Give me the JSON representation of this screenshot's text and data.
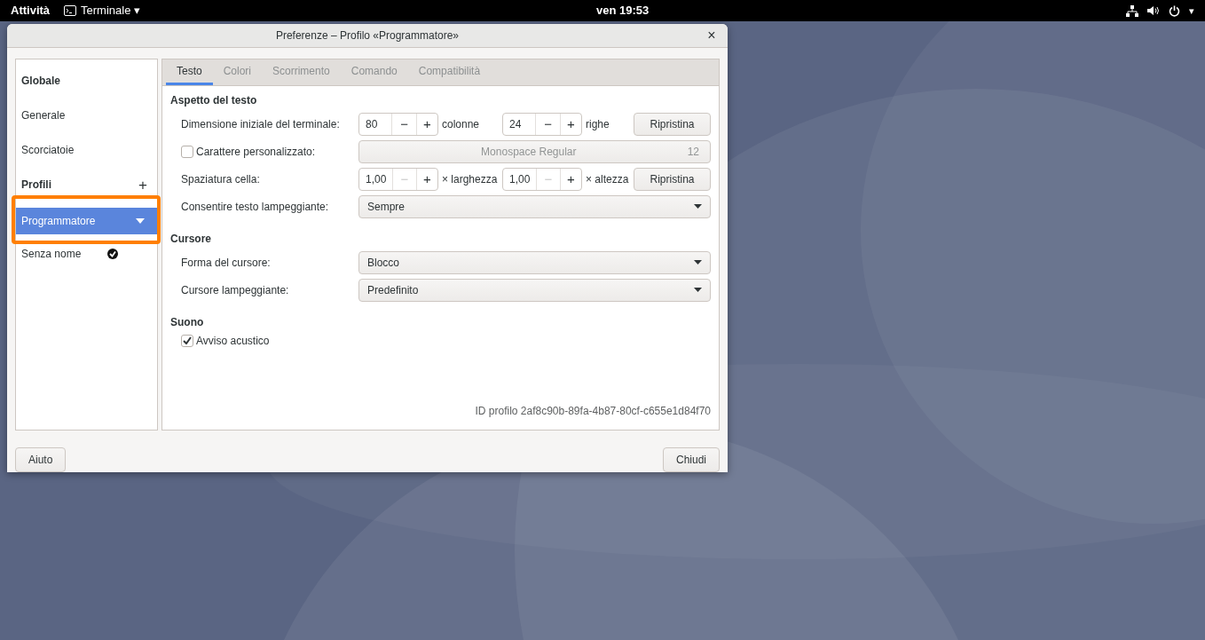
{
  "top_bar": {
    "activities": "Attività",
    "app_menu": {
      "label": "Terminale",
      "caret": "▾"
    },
    "clock": "ven 19:53",
    "system_caret": "▾"
  },
  "dialog": {
    "title": "Preferenze – Profilo «Programmatore»",
    "close": "×"
  },
  "sidebar": {
    "items": [
      {
        "kind": "header",
        "label": "Globale"
      },
      {
        "kind": "item",
        "label": "Generale",
        "selected": false
      },
      {
        "kind": "item",
        "label": "Scorciatoie",
        "selected": false
      },
      {
        "kind": "header",
        "label": "Profili",
        "action": "+"
      },
      {
        "kind": "profile",
        "label": "Programmatore",
        "selected": true,
        "highlighted": true,
        "default": false
      },
      {
        "kind": "profile",
        "label": "Senza nome",
        "selected": false,
        "highlighted": false,
        "default": true
      }
    ]
  },
  "tabs": [
    {
      "label": "Testo",
      "selected": true
    },
    {
      "label": "Colori",
      "selected": false
    },
    {
      "label": "Scorrimento",
      "selected": false
    },
    {
      "label": "Comando",
      "selected": false
    },
    {
      "label": "Compatibilità",
      "selected": false
    }
  ],
  "sections": [
    {
      "title": "Aspetto del testo",
      "rows": [
        {
          "kind": "spins",
          "label": "Dimensione iniziale del terminale:",
          "spins": [
            {
              "value": "80",
              "minus": "−",
              "plus": "+",
              "minus_disabled": false,
              "unit": "colonne"
            },
            {
              "value": "24",
              "minus": "−",
              "plus": "+",
              "minus_disabled": false,
              "unit": "righe"
            }
          ],
          "button": "Ripristina"
        },
        {
          "kind": "font",
          "label": "Carattere personalizzato:",
          "checked": false,
          "font": "Monospace Regular",
          "size": "12",
          "disabled": true
        },
        {
          "kind": "spins",
          "label": "Spaziatura cella:",
          "spins": [
            {
              "value": "1,00",
              "minus": "−",
              "plus": "+",
              "minus_disabled": true,
              "unit": "× larghezza"
            },
            {
              "value": "1,00",
              "minus": "−",
              "plus": "+",
              "minus_disabled": true,
              "unit": "× altezza"
            }
          ],
          "button": "Ripristina"
        },
        {
          "kind": "combo",
          "label": "Consentire testo lampeggiante:",
          "value": "Sempre"
        }
      ]
    },
    {
      "title": "Cursore",
      "rows": [
        {
          "kind": "combo",
          "label": "Forma del cursore:",
          "value": "Blocco"
        },
        {
          "kind": "combo",
          "label": "Cursore lampeggiante:",
          "value": "Predefinito"
        }
      ]
    },
    {
      "title": "Suono",
      "rows": [
        {
          "kind": "checkbox",
          "label": "Avviso acustico",
          "checked": true
        }
      ]
    }
  ],
  "profile_id": {
    "label": "ID profilo",
    "value": "2af8c90b-89fa-4b87-80cf-c655e1d84f70"
  },
  "footer": {
    "buttons": [
      "Aiuto",
      "Chiudi"
    ]
  }
}
